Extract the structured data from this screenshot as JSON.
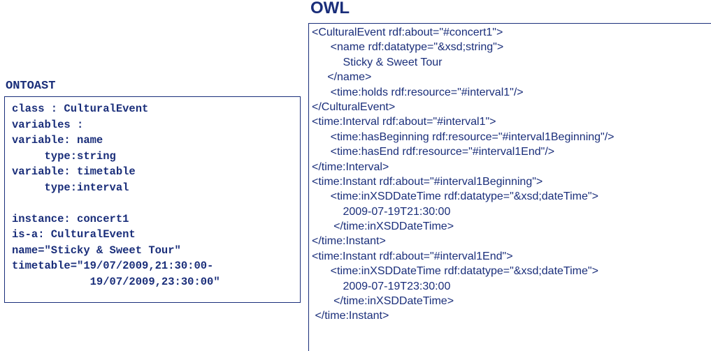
{
  "ontoast": {
    "title": "ONTOAST",
    "lines": [
      "class : CulturalEvent",
      "variables :",
      "variable: name",
      "     type:string",
      "variable: timetable",
      "     type:interval",
      "",
      "instance: concert1",
      "is-a: CulturalEvent",
      "name=\"Sticky & Sweet Tour\"",
      "timetable=\"19/07/2009,21:30:00-",
      "            19/07/2009,23:30:00\""
    ]
  },
  "owl": {
    "title": "OWL",
    "lines": [
      "<CulturalEvent rdf:about=\"#concert1\">",
      "      <name rdf:datatype=\"&xsd;string\">",
      "          Sticky & Sweet Tour",
      "     </name>",
      "      <time:holds rdf:resource=\"#interval1\"/>",
      "</CulturalEvent>",
      "<time:Interval rdf:about=\"#interval1\">",
      "      <time:hasBeginning rdf:resource=\"#interval1Beginning\"/>",
      "      <time:hasEnd rdf:resource=\"#interval1End\"/>",
      "</time:Interval>",
      "<time:Instant rdf:about=\"#interval1Beginning\">",
      "      <time:inXSDDateTime rdf:datatype=\"&xsd;dateTime\">",
      "          2009-07-19T21:30:00",
      "       </time:inXSDDateTime>",
      "</time:Instant>",
      "<time:Instant rdf:about=\"#interval1End\">",
      "      <time:inXSDDateTime rdf:datatype=\"&xsd;dateTime\">",
      "          2009-07-19T23:30:00",
      "       </time:inXSDDateTime>",
      " </time:Instant>"
    ]
  }
}
